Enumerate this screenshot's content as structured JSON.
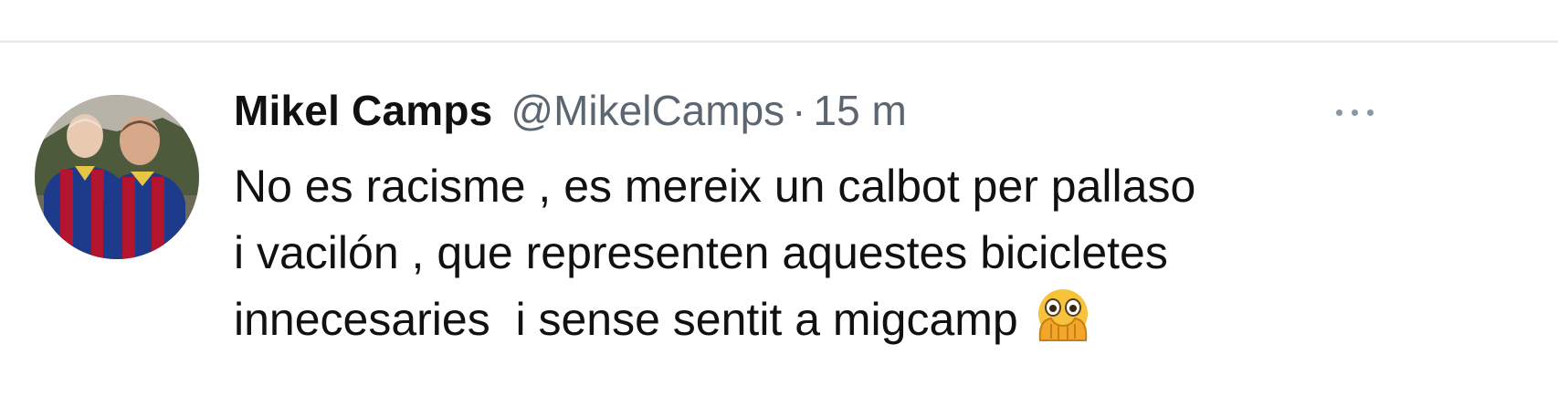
{
  "tweet": {
    "display_name": "Mikel Camps",
    "handle": "@MikelCamps",
    "separator": "·",
    "time": "15 m",
    "text_lines": [
      "No es racisme , es mereix un calbot per pallaso",
      "i vacilón , que representen aquestes bicicletes",
      "innecesaries  i sense sentit a migcamp"
    ],
    "emoji": "face-with-open-eyes-and-hand-over-mouth-icon",
    "more_icon": "more-options-icon"
  },
  "colors": {
    "text_primary": "#111111",
    "text_secondary": "#5b6670",
    "divider": "#ececec",
    "emoji_yellow": "#f6c33b"
  }
}
